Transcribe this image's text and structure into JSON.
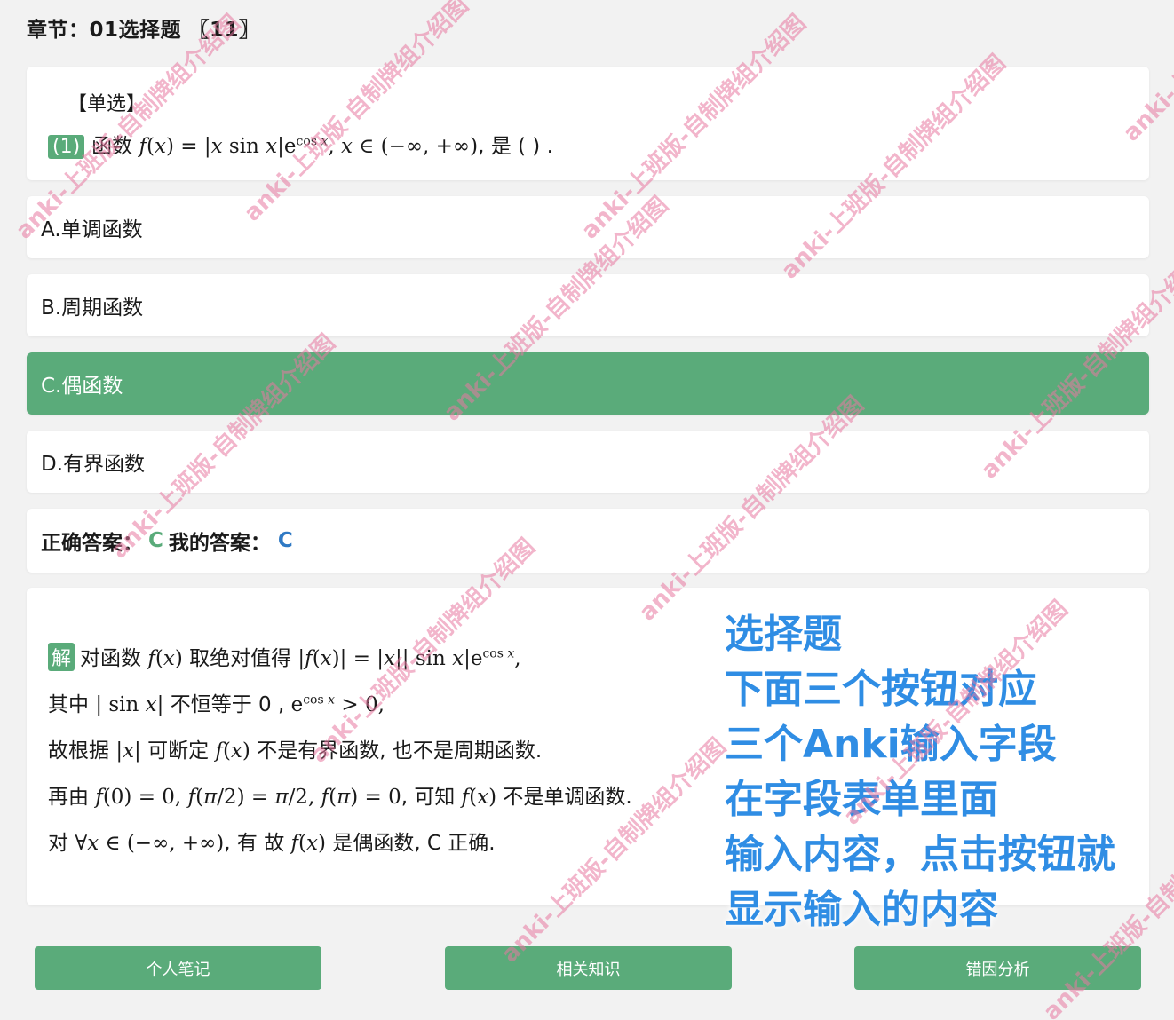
{
  "chapter": "章节：01选择题 〖11〗",
  "question": {
    "type": "【单选】",
    "number": "(1)",
    "stem_prefix": "函数",
    "stem_suffix": ", 是 ( ) ."
  },
  "options": [
    {
      "label": "A.单调函数",
      "selected": false
    },
    {
      "label": "B.周期函数",
      "selected": false
    },
    {
      "label": "C.偶函数",
      "selected": true
    },
    {
      "label": "D.有界函数",
      "selected": false
    }
  ],
  "answer": {
    "correct_label": "正确答案：",
    "correct_value": "C",
    "mine_label": "我的答案：",
    "mine_value": "C"
  },
  "explanation": {
    "badge": "解",
    "line1_text": "对函数",
    "line1_mid": "取绝对值得",
    "line2_text": "其中",
    "line2_mid": "不恒等于 0 ,",
    "line3_text": "故根据",
    "line3_mid": "可断定",
    "line3_end": "不是有界函数, 也不是周期函数.",
    "line4_text": "再由",
    "line4_mid": ", 可知",
    "line4_end": "不是单调函数.",
    "line5_text": "对",
    "line5_mid": ", 有 故",
    "line5_end": "是偶函数, C 正确."
  },
  "overlay_lines": [
    "选择题",
    "下面三个按钮对应",
    "三个Anki输入字段",
    "在字段表单里面",
    "输入内容，点击按钮就",
    "显示输入的内容"
  ],
  "buttons": {
    "notes": "个人笔记",
    "knowledge": "相关知识",
    "analysis": "错因分析"
  },
  "watermark": "anki-上班版-自制牌组介绍图",
  "colors": {
    "accent": "#5aab7a",
    "my_answer": "#2f79c4",
    "overlay": "#2f8de4",
    "watermark": "#e878a0"
  }
}
